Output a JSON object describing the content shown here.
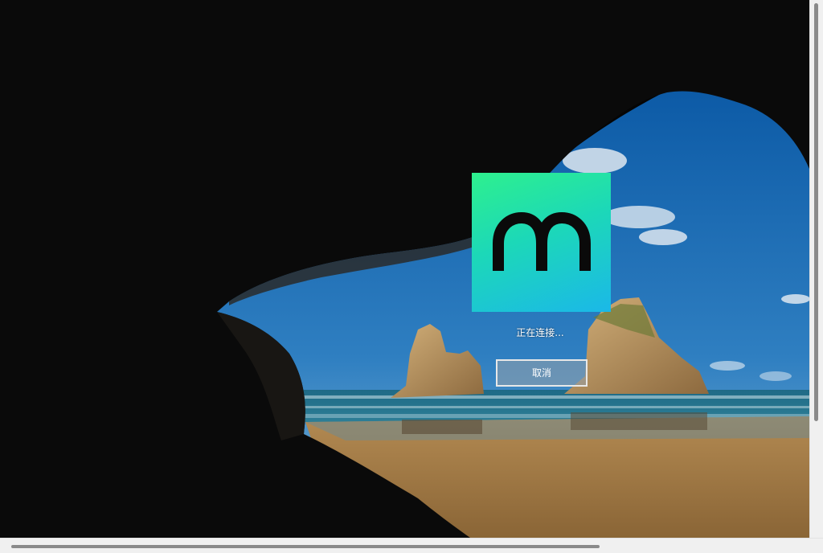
{
  "lock_screen": {
    "status_text": "正在连接...",
    "cancel_label": "取消",
    "logo_icon": "m-logo-icon",
    "logo_colors": [
      "#2ef08e",
      "#1bb8e8"
    ]
  },
  "scrollbars": {
    "vertical_icon": "vertical-scrollbar",
    "horizontal_icon": "horizontal-scrollbar"
  }
}
